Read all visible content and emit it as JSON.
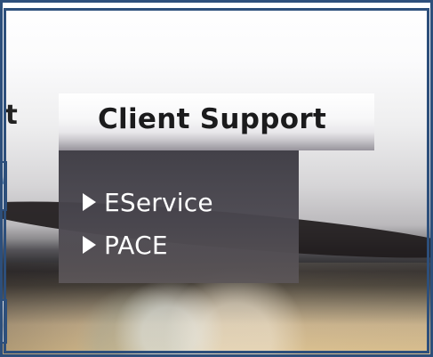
{
  "header": {
    "partial_label": "t",
    "title": "Client Support"
  },
  "menu": {
    "items": [
      {
        "label": "EService",
        "icon": "triangle-right-icon"
      },
      {
        "label": "PACE",
        "icon": "triangle-right-icon"
      }
    ]
  },
  "colors": {
    "frame": "#2d4f7b",
    "menu_background": "#3c3a42",
    "menu_text": "#ffffff",
    "title_text": "#1b1b1c"
  }
}
